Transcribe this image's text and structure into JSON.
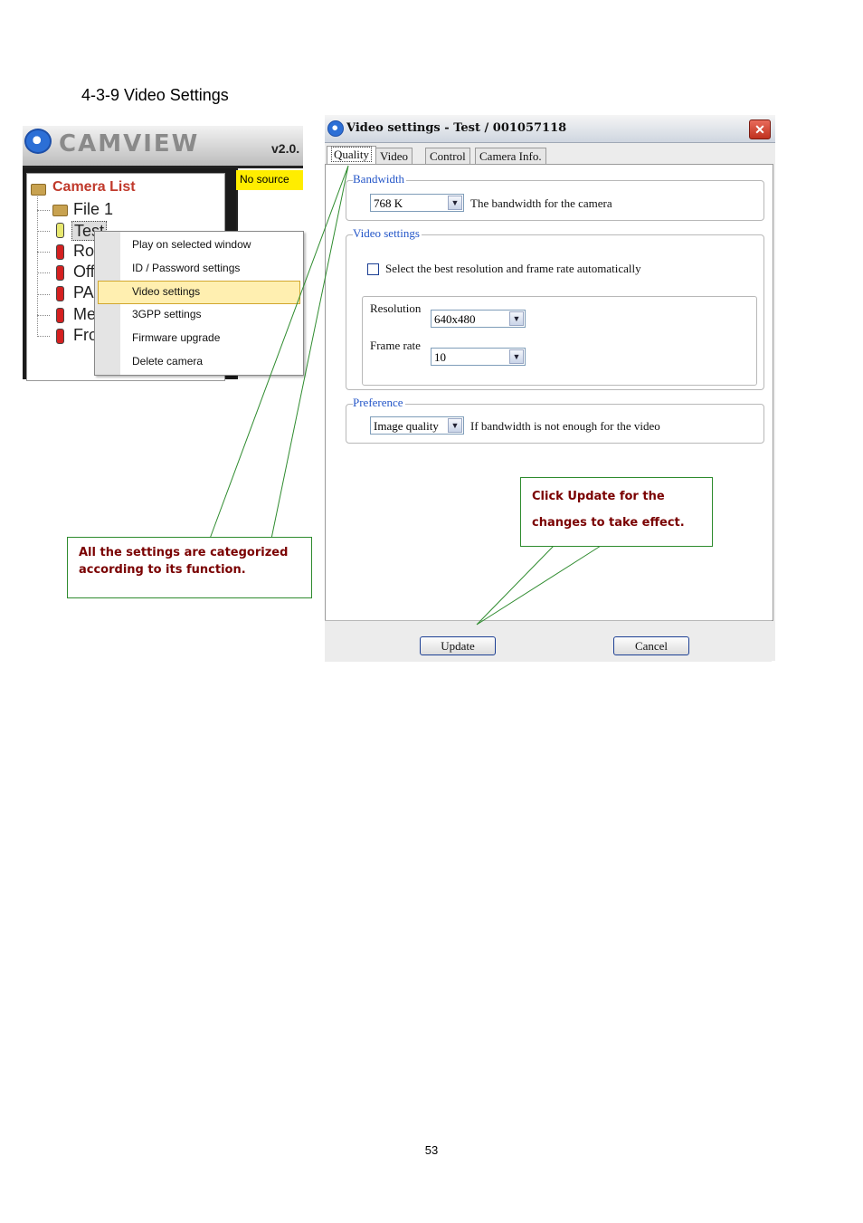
{
  "heading": "4-3-9 Video Settings",
  "camview": {
    "brand": "CAMVIEW",
    "version": "v2.0.",
    "no_source": "No source",
    "camera_list_title": "Camera List",
    "tree": [
      {
        "label": "File 1",
        "icon": "folder-icon"
      },
      {
        "label": "Test",
        "icon": "camera-green-icon",
        "selected": true
      },
      {
        "label": "Ro",
        "icon": "camera-red-icon"
      },
      {
        "label": "Off",
        "icon": "camera-red-icon"
      },
      {
        "label": "PA",
        "icon": "camera-red-icon"
      },
      {
        "label": "Me",
        "icon": "camera-red-icon"
      },
      {
        "label": "Fro",
        "icon": "camera-red-icon"
      }
    ],
    "context_menu": [
      "Play on selected window",
      "ID / Password settings",
      "Video settings",
      "3GPP settings",
      "Firmware upgrade",
      "Delete camera"
    ],
    "context_menu_selected": "Video settings"
  },
  "dialog": {
    "title": "Video settings - Test / 001057118",
    "close": "✕",
    "tabs": [
      "Quality",
      "Video",
      "Control",
      "Camera Info."
    ],
    "active_tab": "Quality",
    "bandwidth": {
      "legend": "Bandwidth",
      "value": "768 K",
      "description": "The bandwidth for the camera"
    },
    "video_settings": {
      "legend": "Video settings",
      "auto_checkbox_label": "Select the best resolution and frame rate automatically",
      "auto_checked": false,
      "resolution_label": "Resolution",
      "resolution_value": "640x480",
      "frame_rate_label": "Frame rate",
      "frame_rate_value": "10"
    },
    "preference": {
      "legend": "Preference",
      "value": "Image quality",
      "description": "If bandwidth is not enough for the video"
    },
    "update_button": "Update",
    "cancel_button": "Cancel"
  },
  "callouts": {
    "categorized": "All the settings are categorized according to its function.",
    "update_line1": "Click Update for the",
    "update_line2": "changes to take effect."
  },
  "colors": {
    "legend_blue": "#2456c8",
    "callout_text": "#7a0000",
    "callout_border": "#2e8b2e",
    "highlight": "#ffefb0",
    "camera_list_title": "#c0392b"
  },
  "page_number": "53"
}
